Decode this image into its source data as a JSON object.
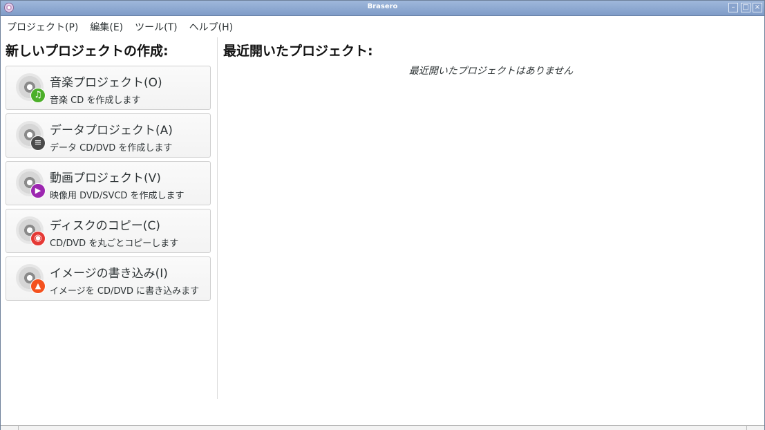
{
  "window": {
    "title": "Brasero"
  },
  "menubar": {
    "items": [
      "プロジェクト(P)",
      "編集(E)",
      "ツール(T)",
      "ヘルプ(H)"
    ]
  },
  "left_panel": {
    "heading": "新しいプロジェクトの作成:",
    "projects": [
      {
        "title": "音楽プロジェクト(O)",
        "description": "音楽 CD を作成します",
        "icon": "music-note-icon",
        "badge_color": "#4caf2a",
        "glyph": "♫"
      },
      {
        "title": "データプロジェクト(A)",
        "description": "データ CD/DVD を作成します",
        "icon": "data-list-icon",
        "badge_color": "#4a4a4a",
        "glyph": "≡"
      },
      {
        "title": "動画プロジェクト(V)",
        "description": "映像用 DVD/SVCD を作成します",
        "icon": "play-icon",
        "badge_color": "#9c27b0",
        "glyph": "▶"
      },
      {
        "title": "ディスクのコピー(C)",
        "description": "CD/DVD を丸ごとコピーします",
        "icon": "disc-copy-icon",
        "badge_color": "#e53935",
        "glyph": "◉"
      },
      {
        "title": "イメージの書き込み(I)",
        "description": "イメージを CD/DVD に書き込みます",
        "icon": "flame-icon",
        "badge_color": "#f4511e",
        "glyph": "🔥"
      }
    ]
  },
  "right_panel": {
    "heading": "最近開いたプロジェクト:",
    "empty_message": "最近開いたプロジェクトはありません"
  }
}
